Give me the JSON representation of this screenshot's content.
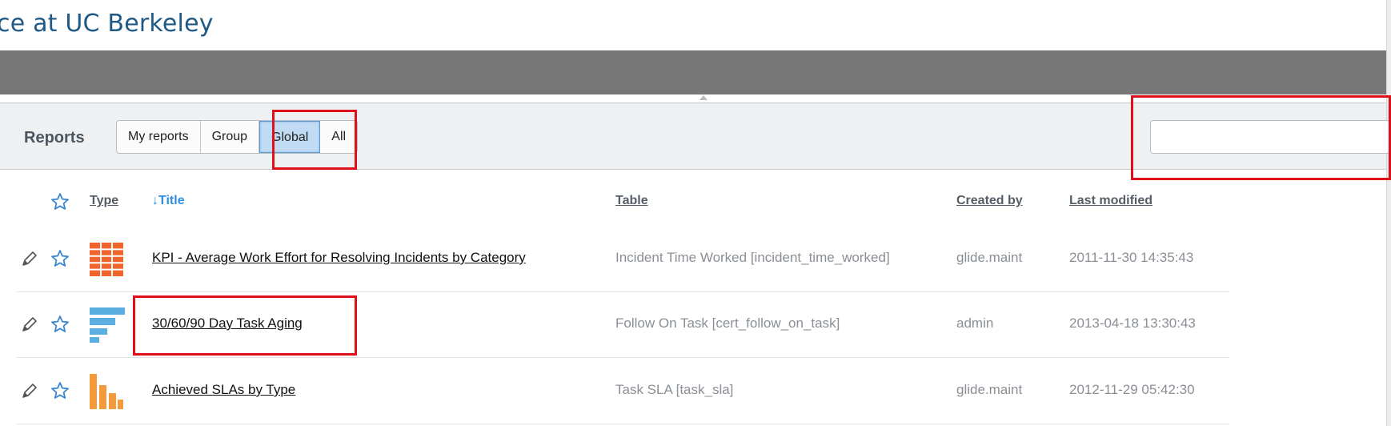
{
  "page": {
    "title": "ce at UC Berkeley"
  },
  "toolbar": {
    "label": "Reports",
    "filters": [
      "My reports",
      "Group",
      "Global",
      "All"
    ],
    "active_filter": "Global",
    "search_value": "",
    "search_placeholder": ""
  },
  "table": {
    "columns": {
      "type": "Type",
      "title": "↓Title",
      "table": "Table",
      "created_by": "Created by",
      "last_modified": "Last modified"
    },
    "rows": [
      {
        "icon": "heatmap-report-icon",
        "icon_color": "#f0642d",
        "title": "KPI - Average Work Effort for Resolving Incidents by Category",
        "table": "Incident Time Worked [incident_time_worked]",
        "created_by": "glide.maint",
        "last_modified": "2011-11-30 14:35:43"
      },
      {
        "icon": "horizontal-bar-report-icon",
        "icon_color": "#5aaee2",
        "title": "30/60/90 Day Task Aging",
        "table": "Follow On Task [cert_follow_on_task]",
        "created_by": "admin",
        "last_modified": "2013-04-18 13:30:43"
      },
      {
        "icon": "vertical-bar-report-icon",
        "icon_color": "#f59a3a",
        "title": "Achieved SLAs by Type",
        "table": "Task SLA [task_sla]",
        "created_by": "glide.maint",
        "last_modified": "2012-11-29 05:42:30"
      }
    ]
  },
  "colors": {
    "accent": "#2e8ee0",
    "highlight": "#e0101b",
    "banner": "#777777"
  }
}
